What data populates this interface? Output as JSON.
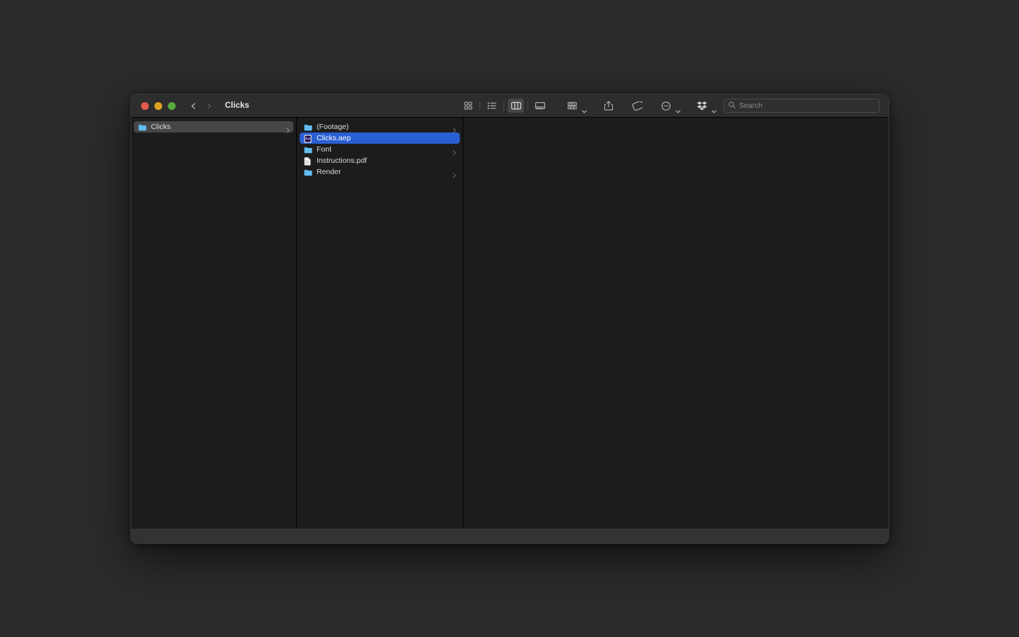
{
  "window": {
    "title": "Clicks",
    "traffic_lights": [
      {
        "name": "close",
        "color": "#e05a4f"
      },
      {
        "name": "minimize",
        "color": "#dfa123"
      },
      {
        "name": "zoom",
        "color": "#57ac3e"
      }
    ]
  },
  "toolbar": {
    "back_label": "Back",
    "forward_label": "Forward",
    "view_modes": [
      {
        "id": "icon",
        "label": "Icon View",
        "icon": "grid-icon",
        "active": false
      },
      {
        "id": "list",
        "label": "List View",
        "icon": "list-icon",
        "active": false
      },
      {
        "id": "column",
        "label": "Column View",
        "icon": "columns-icon",
        "active": true
      },
      {
        "id": "gallery",
        "label": "Gallery View",
        "icon": "gallery-icon",
        "active": false
      }
    ],
    "group_label": "Group",
    "share_label": "Share",
    "tag_label": "Tags",
    "more_label": "More",
    "dropbox_label": "Dropbox"
  },
  "search": {
    "placeholder": "Search",
    "value": ""
  },
  "columns": [
    {
      "id": "column-1",
      "items": [
        {
          "name": "Clicks",
          "icon": "folder-icon",
          "kind": "folder",
          "selected": "grey",
          "chevron": true
        }
      ]
    },
    {
      "id": "column-2",
      "items": [
        {
          "name": "(Footage)",
          "icon": "folder-icon",
          "kind": "folder",
          "selected": "none",
          "chevron": true
        },
        {
          "name": "Clicks.aep",
          "icon": "after-effects-icon",
          "kind": "file",
          "selected": "blue",
          "chevron": false
        },
        {
          "name": "Font",
          "icon": "folder-icon",
          "kind": "folder",
          "selected": "none",
          "chevron": true
        },
        {
          "name": "Instructions.pdf",
          "icon": "pdf-document-icon",
          "kind": "file",
          "selected": "none",
          "chevron": false
        },
        {
          "name": "Render",
          "icon": "folder-icon",
          "kind": "folder",
          "selected": "none",
          "chevron": true
        }
      ]
    },
    {
      "id": "column-3",
      "items": []
    }
  ],
  "colors": {
    "selection_blue": "#2a5fd4",
    "selection_grey": "#474747",
    "folder_blue": "#4bb0e8",
    "window_bg": "#1c1c1c",
    "toolbar_bg": "#2d2d2d",
    "desktop_bg": "#2b2b2b"
  }
}
